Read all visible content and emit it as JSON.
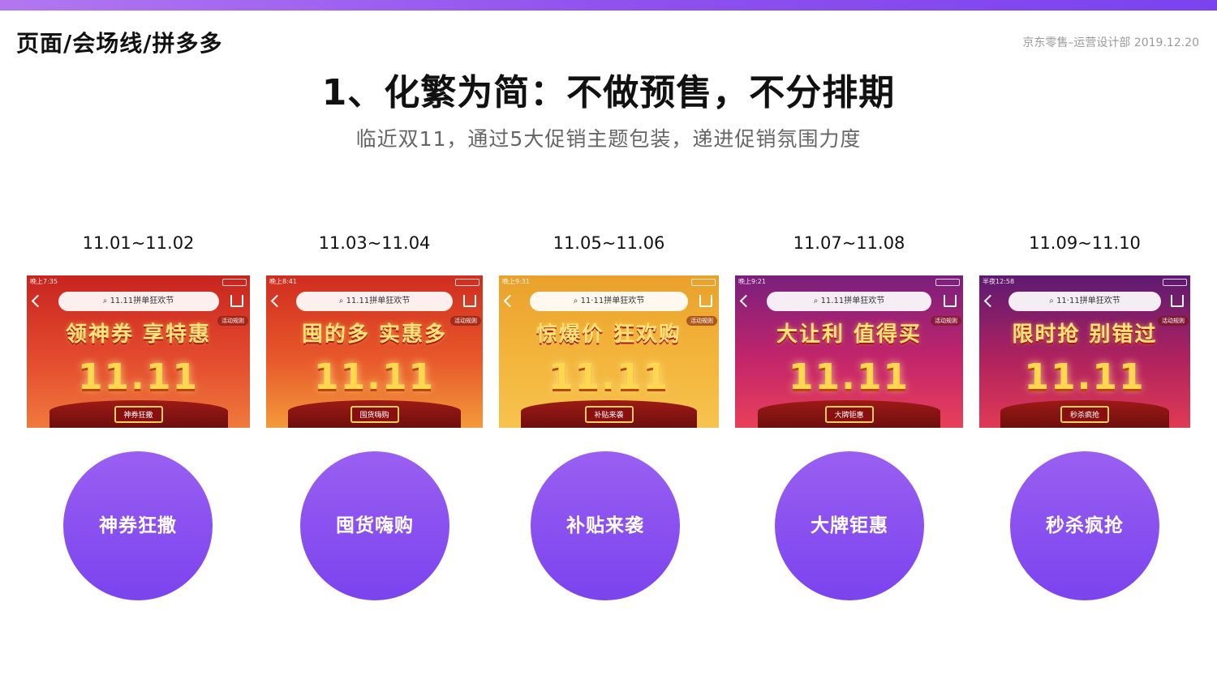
{
  "header": {
    "breadcrumb": "页面/会场线/拼多多",
    "credit": "京东零售–运营设计部  2019.12.20"
  },
  "headline": "1、化繁为简：不做预售，不分排期",
  "subheadline": "临近双11，通过5大促销主题包装，递进促销氛围力度",
  "phases": [
    {
      "date": "11.01~11.02",
      "status_time": "晚上7:35",
      "search_text": "11.11拼单狂欢节",
      "banner_title": "领神券 享特惠",
      "banner_big": "11.11",
      "rules_badge": "活动规则",
      "plaque": "神券狂撒",
      "circle_label": "神券狂撒"
    },
    {
      "date": "11.03~11.04",
      "status_time": "晚上8:41",
      "search_text": "11.11拼单狂欢节",
      "banner_title": "囤的多 实惠多",
      "banner_big": "11.11",
      "rules_badge": "活动规则",
      "plaque": "囤货嗨购",
      "circle_label": "囤货嗨购"
    },
    {
      "date": "11.05~11.06",
      "status_time": "晚上9:31",
      "search_text": "11·11拼单狂欢节",
      "banner_title": "惊爆价 狂欢购",
      "banner_big": "11.11",
      "rules_badge": "活动规则",
      "plaque": "补贴来袭",
      "circle_label": "补贴来袭"
    },
    {
      "date": "11.07~11.08",
      "status_time": "晚上9:21",
      "search_text": "11.11拼单狂欢节",
      "banner_title": "大让利 值得买",
      "banner_big": "11.11",
      "rules_badge": "活动规则",
      "plaque": "大牌钜惠",
      "circle_label": "大牌钜惠"
    },
    {
      "date": "11.09~11.10",
      "status_time": "半夜12:58",
      "search_text": "11·11拼单狂欢节",
      "banner_title": "限时抢 别错过",
      "banner_big": "11.11",
      "rules_badge": "活动规则",
      "plaque": "秒杀疯抢",
      "circle_label": "秒杀疯抢"
    }
  ],
  "colors": {
    "accent_purple": "#7b43ee",
    "accent_purple_light": "#9a5ff1"
  }
}
